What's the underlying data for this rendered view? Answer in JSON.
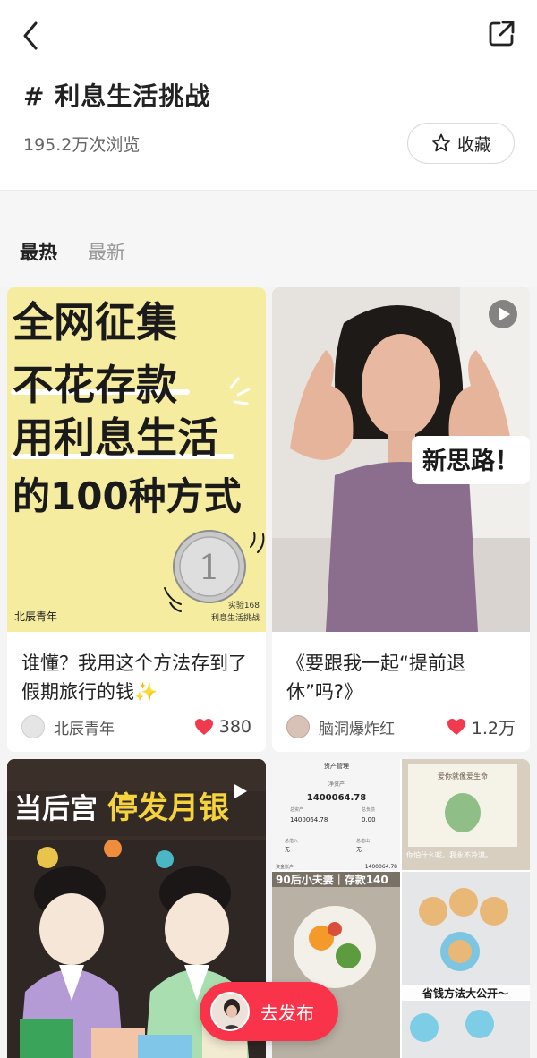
{
  "header": {
    "topic_title": "# 利息生活挑战",
    "views": "195.2万次浏览",
    "favorite_label": "收藏"
  },
  "tabs": [
    {
      "label": "最热",
      "active": true
    },
    {
      "label": "最新",
      "active": false
    }
  ],
  "cards": [
    {
      "image_text": {
        "lines": [
          "全网征集",
          "不花存款",
          "用利息生活",
          "的100种方式"
        ],
        "brand": "北辰青年",
        "corner_lines": [
          "实验168",
          "利息生活挑战"
        ]
      },
      "title": "谁懂？我用这个方法存到了假期旅行的钱✨",
      "author": "北辰青年",
      "likes": "380"
    },
    {
      "image_text": {
        "sticker": "新思路！"
      },
      "title": "《要跟我一起“提前退休”吗?》",
      "author": "脑洞爆炸红",
      "likes": "1.2万"
    },
    {
      "image_text": {
        "banner_white": "当后宫",
        "banner_yellow": "停发月银"
      }
    },
    {
      "image_text": {
        "app_title": "资产管理",
        "net_label": "净资产",
        "net_value": "1400064.78",
        "assets_label": "总资产",
        "assets_value": "1400064.78",
        "debt_label": "总负债",
        "debt_value": "0.00",
        "in_label": "总借入",
        "in_value": "无",
        "out_label": "总借出",
        "out_value": "无",
        "fund_label": "资金账户",
        "fund_value": "1400064.78",
        "couple_text": "90后小夫妻｜存款140",
        "book_quote": "你怕什么呢，我永不冷漠。",
        "book_title": "爱你就像爱生命",
        "savings_text": "省钱方法大公开～"
      }
    }
  ],
  "publish": {
    "label": "去发布"
  },
  "colors": {
    "accent": "#f9344a",
    "heart": "#f23a4f",
    "card1_bg": "#f6ec9f"
  }
}
